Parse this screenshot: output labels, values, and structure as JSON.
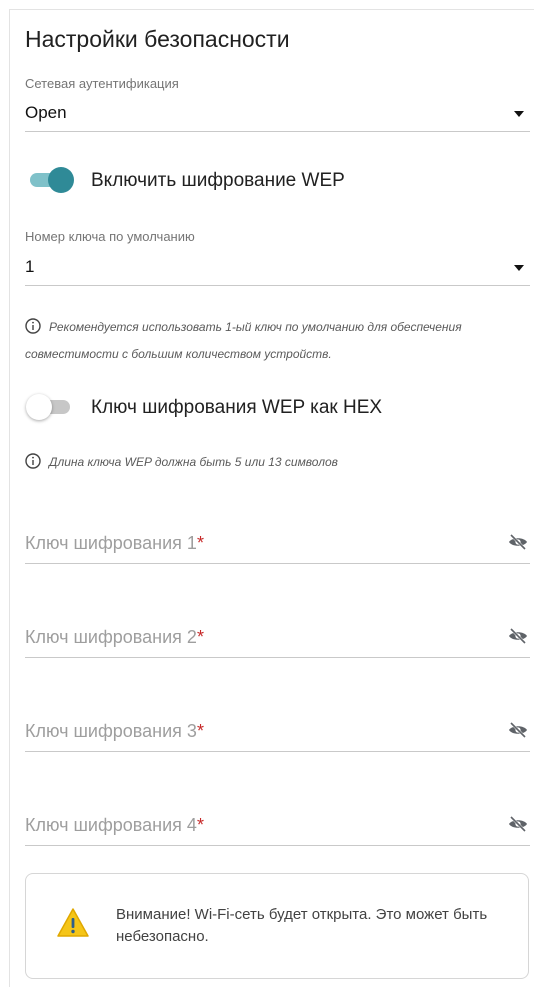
{
  "title": "Настройки безопасности",
  "auth": {
    "label": "Сетевая аутентификация",
    "value": "Open"
  },
  "wep_toggle": {
    "label": "Включить шифрование WEP",
    "on": true
  },
  "default_key": {
    "label": "Номер ключа по умолчанию",
    "value": "1"
  },
  "default_key_hint": "Рекомендуется использовать 1-ый ключ по умолчанию для обеспечения совместимости с большим количеством устройств.",
  "hex_toggle": {
    "label": "Ключ шифрования WEP как HEX",
    "on": false
  },
  "length_hint": "Длина ключа WEP должна быть 5 или 13 символов",
  "keys": [
    {
      "placeholder": "Ключ шифрования 1",
      "required_mark": "*"
    },
    {
      "placeholder": "Ключ шифрования 2",
      "required_mark": "*"
    },
    {
      "placeholder": "Ключ шифрования 3",
      "required_mark": "*"
    },
    {
      "placeholder": "Ключ шифрования 4",
      "required_mark": "*"
    }
  ],
  "warning": "Внимание! Wi-Fi-сеть будет открыта. Это может быть небезопасно.",
  "colors": {
    "accent": "#2f8a97",
    "accent_light": "#7fc1c9",
    "required": "#c62828",
    "warning_icon": "#f5c518"
  },
  "icons": {
    "info": "info-circle-icon",
    "eye": "eye-off-icon",
    "warning": "warning-triangle-icon",
    "caret": "caret-down-icon"
  }
}
